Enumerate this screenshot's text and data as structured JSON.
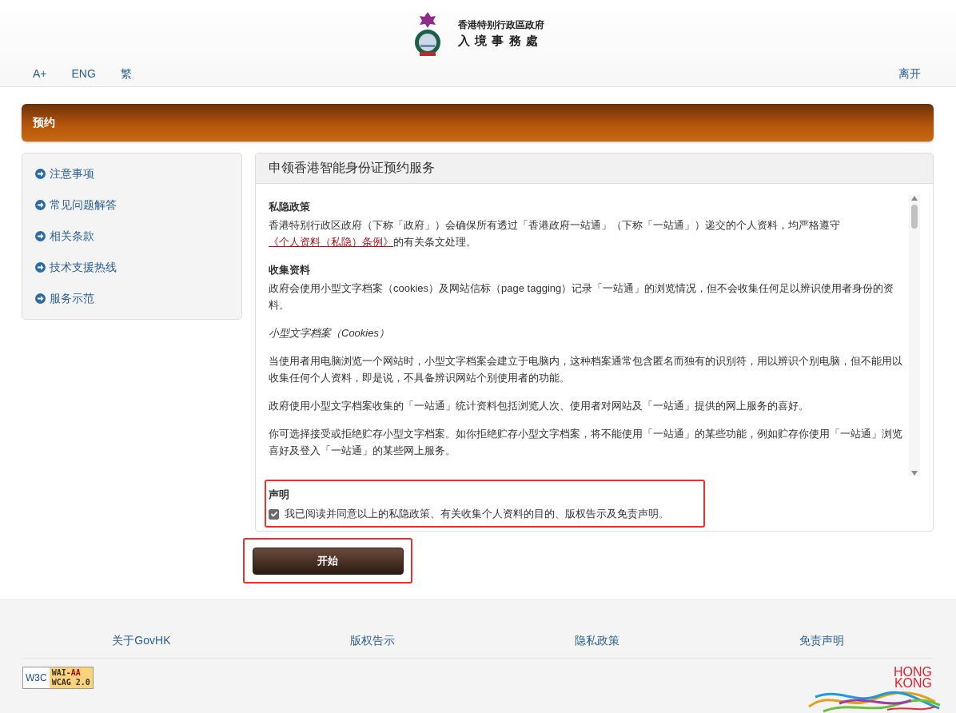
{
  "header": {
    "logo_line1": "香港特别行政區政府",
    "logo_line2": "入 境 事 務 處",
    "tools": [
      "A+",
      "ENG",
      "繁"
    ],
    "exit": "离开"
  },
  "banner": {
    "title": "预约"
  },
  "sidebar": {
    "items": [
      {
        "label": "注意事项"
      },
      {
        "label": "常见问题解答"
      },
      {
        "label": "相关条款"
      },
      {
        "label": "技术支援热线"
      },
      {
        "label": "服务示范"
      }
    ]
  },
  "panel": {
    "title": "申领香港智能身份证预约服务",
    "content": [
      {
        "kind": "heading",
        "text": "私隐政策"
      },
      {
        "kind": "linked",
        "before": "香港特别行政区政府（下称「政府」）会确保所有透过「香港政府一站通」（下称「一站通」）递交的个人资料，均严格遵守",
        "link": "《个人资料（私隐）条例》",
        "after": "的有关条文处理。"
      },
      {
        "kind": "heading",
        "text": "收集资料"
      },
      {
        "kind": "text",
        "text": "政府会使用小型文字档案（cookies）及网站信标（page tagging）记录「一站通」的浏览情况，但不会收集任何足以辨识使用者身份的资料。"
      },
      {
        "kind": "italic",
        "text": "小型文字档案（Cookies）"
      },
      {
        "kind": "text",
        "text": "当使用者用电脑浏览一个网站时，小型文字档案会建立于电脑内，这种档案通常包含匿名而独有的识别符，用以辨识个别电脑，但不能用以收集任何个人资料，即是说，不具备辨识网站个别使用者的功能。"
      },
      {
        "kind": "text",
        "text": "政府使用小型文字档案收集的「一站通」统计资料包括浏览人次、使用者对网站及「一站通」提供的网上服务的喜好。"
      },
      {
        "kind": "text",
        "text": "你可选择接受或拒绝贮存小型文字档案。如你拒绝贮存小型文字档案，将不能使用「一站通」的某些功能，例如贮存你使用「一站通」浏览喜好及登入「一站通」的某些网上服务。"
      }
    ],
    "declaration": {
      "title": "声明",
      "label": "我已阅读并同意以上的私隐政策、有关收集个人资料的目的、版权告示及免责声明。",
      "checked": true
    }
  },
  "start_button": "开始",
  "footer": {
    "links": [
      "关于GovHK",
      "版权告示",
      "隐私政策",
      "免责声明"
    ],
    "badge_w3c": "W3C",
    "badge_line1a": "WAI-",
    "badge_line1b": "AA",
    "badge_line2": "WCAG 2.0",
    "brand_line1": "HONG",
    "brand_line2": "KONG"
  }
}
